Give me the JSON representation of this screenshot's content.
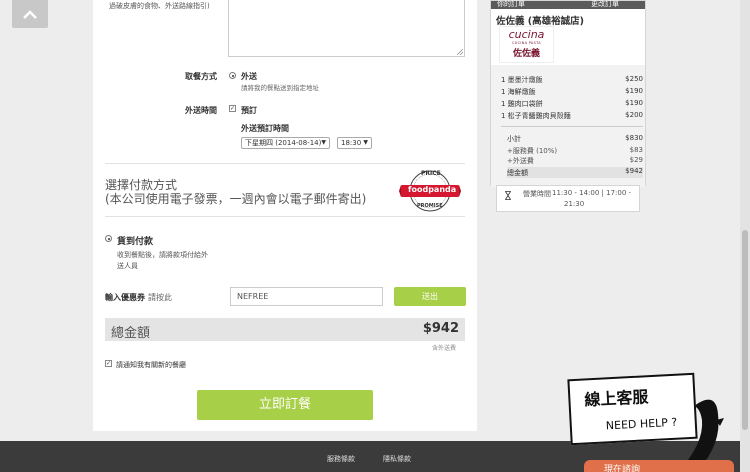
{
  "address": {
    "note": "過破皮膚的食物、外送路線指引)"
  },
  "delivery": {
    "method_label": "取餐方式",
    "method_value": "外送",
    "method_desc": "請將我的餐點送到指定地址",
    "time_label": "外送時間",
    "time_value": "預訂",
    "preorder_label": "外送預訂時間",
    "date_select": "下星期四 (2014-08-14)",
    "time_select": "18:30"
  },
  "payment": {
    "title_line1": "選擇付款方式",
    "title_line2": "(本公司使用電子發票，一週內會以電子郵件寄出)",
    "badge_top": "PRICE",
    "badge_brand": "foodpanda",
    "badge_bottom": "PROMISE",
    "option_label": "貨到付款",
    "option_desc_line1": "收到餐點後，請將款項付給外",
    "option_desc_line2": "送人員"
  },
  "coupon": {
    "label": "輸入優惠券",
    "hint": "請按此",
    "value": "NEFREE",
    "send_label": "送出"
  },
  "total": {
    "label": "總金額",
    "value": "$942",
    "fee_note": "含外送費"
  },
  "newsletter": {
    "label": "請通知我有關新的餐廳"
  },
  "order_button": "立即訂餐",
  "footer": {
    "links": [
      "服務條款",
      "隱私條款"
    ]
  },
  "cart": {
    "head_left": "你的訂單",
    "head_right": "更改訂單",
    "shop_name": "佐佐義 (高雄裕誠店)",
    "logo_line1": "cucina",
    "logo_line2": "CUCINA PASTA",
    "logo_line3": "佐佐義",
    "items": [
      {
        "name": "1 墨墨汁燉飯",
        "price": "$250"
      },
      {
        "name": "1 海鮮燉飯",
        "price": "$190"
      },
      {
        "name": "1 雞肉口袋餅",
        "price": "$190"
      },
      {
        "name": "1 松子青醬雞肉貝殼麵",
        "price": "$200"
      }
    ],
    "subtotal_label": "小計",
    "subtotal_value": "$830",
    "service_label": "+服務費 (10%)",
    "service_value": "$83",
    "delivery_label": "+外送費",
    "delivery_value": "$29",
    "total_label": "總金額",
    "total_value": "$942",
    "hours_label": "營業時間",
    "hours_line1": "11:30 - 14:00 | 17:00 -",
    "hours_line2": "21:30"
  },
  "help": {
    "title": "線上客服",
    "subtitle": "NEED HELP ?",
    "chat_tab": "現在諮詢"
  }
}
